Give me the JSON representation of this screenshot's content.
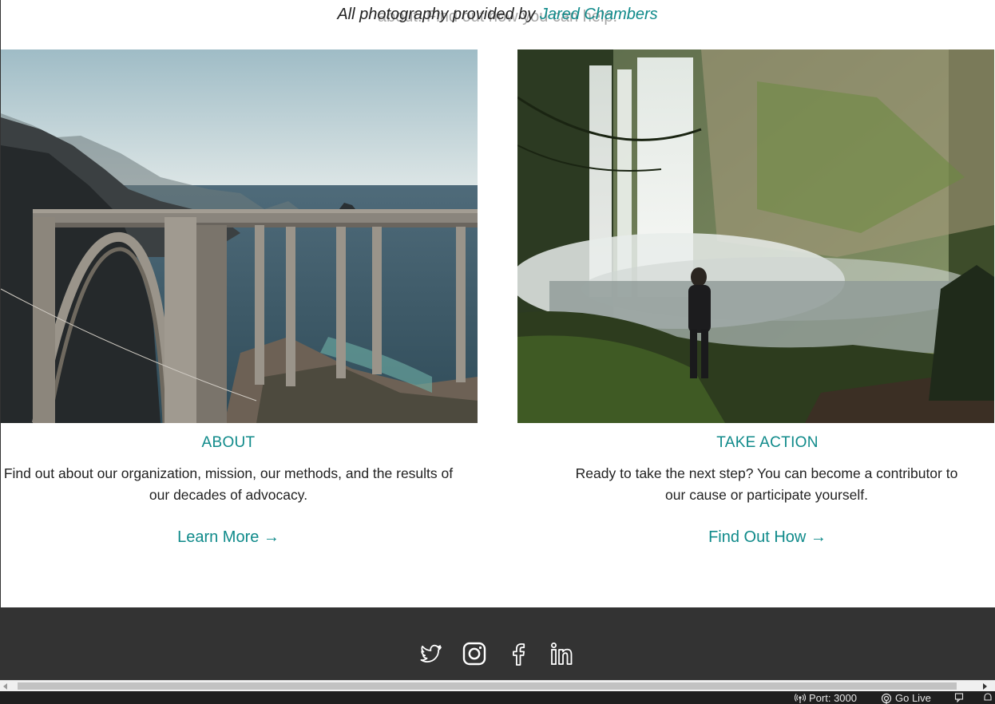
{
  "credit": {
    "prefix": "All photography provided by ",
    "author": "Jared Chambers",
    "ghost": "about. Find out how you can help."
  },
  "cards": [
    {
      "title": "ABOUT",
      "text": "Find out about our organization, mission, our methods, and the results of our decades of advocacy.",
      "link": "Learn More →"
    },
    {
      "title": "TAKE ACTION",
      "text": "Ready to take the next step? You can become a contributor to our cause or participate yourself.",
      "link": "Find Out How →"
    }
  ],
  "footer": {
    "social": [
      "twitter-icon",
      "instagram-icon",
      "facebook-icon",
      "linkedin-icon"
    ]
  },
  "statusbar": {
    "port": "Port: 3000",
    "golive": "Go Live"
  },
  "colors": {
    "accent": "#0f8a8a",
    "footer_bg": "#333333",
    "statusbar_bg": "#1f1f1f"
  }
}
